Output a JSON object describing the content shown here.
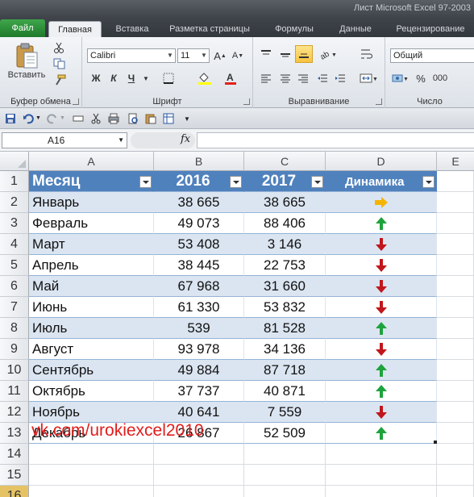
{
  "window": {
    "title": "Лист Microsoft Excel 97-2003"
  },
  "tabs": [
    {
      "label": "Файл"
    },
    {
      "label": "Главная"
    },
    {
      "label": "Вставка"
    },
    {
      "label": "Разметка страницы"
    },
    {
      "label": "Формулы"
    },
    {
      "label": "Данные"
    },
    {
      "label": "Рецензирование"
    }
  ],
  "ribbon": {
    "clipboard": {
      "label": "Буфер обмена",
      "paste_label": "Вставить"
    },
    "font": {
      "label": "Шрифт",
      "font_name": "Calibri",
      "font_size": "11",
      "bold": "Ж",
      "italic": "К",
      "underline": "Ч"
    },
    "alignment": {
      "label": "Выравнивание"
    },
    "number": {
      "label": "Число",
      "format": "Общий",
      "percent": "%",
      "thousands": "000"
    }
  },
  "formula_bar": {
    "name_box": "A16",
    "fx": "fx",
    "value": ""
  },
  "columns": [
    "A",
    "B",
    "C",
    "D",
    "E"
  ],
  "rows": [
    "1",
    "2",
    "3",
    "4",
    "5",
    "6",
    "7",
    "8",
    "9",
    "10",
    "11",
    "12",
    "13",
    "14",
    "15",
    "16"
  ],
  "table": {
    "headers": [
      "Месяц",
      "2016",
      "2017",
      "Динамика"
    ],
    "data": [
      {
        "month": "Январь",
        "y2016": "38 665",
        "y2017": "38 665",
        "trend": "flat"
      },
      {
        "month": "Февраль",
        "y2016": "49 073",
        "y2017": "88 406",
        "trend": "up"
      },
      {
        "month": "Март",
        "y2016": "53 408",
        "y2017": "3 146",
        "trend": "down"
      },
      {
        "month": "Апрель",
        "y2016": "38 445",
        "y2017": "22 753",
        "trend": "down"
      },
      {
        "month": "Май",
        "y2016": "67 968",
        "y2017": "31 660",
        "trend": "down"
      },
      {
        "month": "Июнь",
        "y2016": "61 330",
        "y2017": "53 832",
        "trend": "down"
      },
      {
        "month": "Июль",
        "y2016": "539",
        "y2017": "81 528",
        "trend": "up"
      },
      {
        "month": "Август",
        "y2016": "93 978",
        "y2017": "34 136",
        "trend": "down"
      },
      {
        "month": "Сентябрь",
        "y2016": "49 884",
        "y2017": "87 718",
        "trend": "up"
      },
      {
        "month": "Октябрь",
        "y2016": "37 737",
        "y2017": "40 871",
        "trend": "up"
      },
      {
        "month": "Ноябрь",
        "y2016": "40 641",
        "y2017": "7 559",
        "trend": "down"
      },
      {
        "month": "Декабрь",
        "y2016": "26 867",
        "y2017": "52 509",
        "trend": "up"
      }
    ],
    "trend_colors": {
      "up": "#1ea33c",
      "down": "#c0171c",
      "flat": "#f5b400"
    },
    "header_color": "#4f81bd",
    "band_color": "#dbe5f1"
  },
  "watermark": "vk.com/urokiexcel2010"
}
